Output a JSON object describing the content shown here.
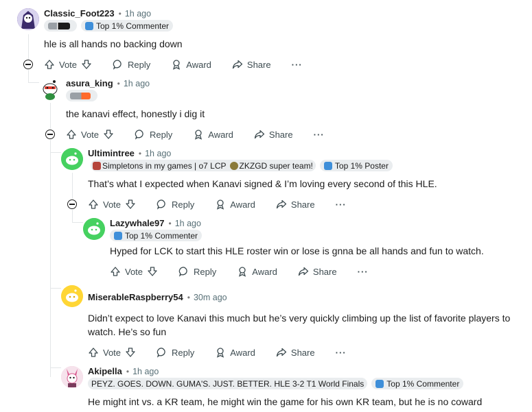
{
  "comments": [
    {
      "user": "Classic_Foot223",
      "time": "1h ago",
      "flairs": [
        "",
        "Top 1% Commenter"
      ],
      "body": "hle is all hands no backing down",
      "avatar_color": "#6b4aa8"
    },
    {
      "user": "asura_king",
      "time": "1h ago",
      "flairs": [
        ""
      ],
      "body": "the kanavi effect, honestly i dig it",
      "avatar_color": "#ffffff"
    },
    {
      "user": "Ultimintree",
      "time": "1h ago",
      "flairs": [
        "Simpletons in my games | o7 LCP",
        "ZKZGD super team!",
        "Top 1% Poster"
      ],
      "body": "That’s what I expected when Kanavi signed & I’m loving every second of this HLE.",
      "avatar_color": "#46d160"
    },
    {
      "user": "Lazywhale97",
      "time": "1h ago",
      "flairs": [
        "Top 1% Commenter"
      ],
      "body": "Hyped for LCK to start this HLE roster win or lose is gnna be all hands and fun to watch.",
      "avatar_color": "#46d160"
    },
    {
      "user": "MiserableRaspberry54",
      "time": "30m ago",
      "flairs": [],
      "body": "Didn’t expect to love Kanavi this much but he’s very quickly climbing up the list of favorite players to",
      "body2": "watch. He’s so fun",
      "avatar_color": "#ffd635"
    },
    {
      "user": "Akipella",
      "time": "1h ago",
      "flairs": [
        "PEYZ. GOES. DOWN. GUMA'S. JUST. BETTER. HLE 3-2 T1 World Finals",
        "Top 1% Commenter"
      ],
      "body": "He might int vs. a KR team, he might win the game for his own KR team, but he is no coward",
      "avatar_color": "#f4c0d6"
    }
  ],
  "actions": {
    "vote": "Vote",
    "reply": "Reply",
    "award": "Award",
    "share": "Share",
    "more": "···"
  }
}
